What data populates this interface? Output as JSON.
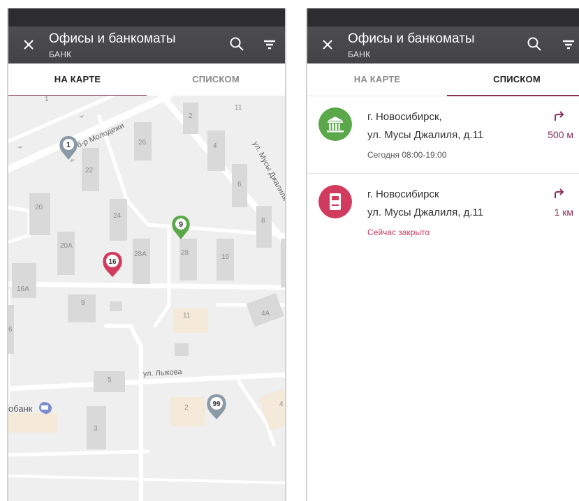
{
  "header": {
    "title": "Офисы и банкоматы",
    "subtitle": "БАНК"
  },
  "tabs": [
    {
      "label": "НА КАРТЕ"
    },
    {
      "label": "СПИСКОМ"
    }
  ],
  "map": {
    "streets": [
      "б-р Молодежи",
      "ул. Мусы Джалиля",
      "ул. Лыкова"
    ],
    "buildings": [
      "2",
      "26",
      "4",
      "22",
      "6",
      "20",
      "24",
      "8",
      "20А",
      "28А",
      "28",
      "10",
      "16А",
      "9",
      "11",
      "4А",
      "6",
      "5",
      "2",
      "4",
      "3",
      "11",
      "1"
    ],
    "poi_label": "обанк",
    "markers": [
      {
        "label": "1",
        "color": "#8a9aa6"
      },
      {
        "label": "9",
        "color": "#5aa84a"
      },
      {
        "label": "16",
        "color": "#d13b5e"
      },
      {
        "label": "99",
        "color": "#8a9aa6"
      }
    ]
  },
  "list": {
    "items": [
      {
        "line1": "г. Новосибирск,",
        "line2": "ул. Мусы Джалиля, д.11",
        "status": "Сегодня 08:00-19:00",
        "distance": "500 м",
        "icon": "bank-building-icon",
        "color": "#5aa84a"
      },
      {
        "line1": "г. Новосибирск",
        "line2": "ул. Мусы Джалиля, д.11",
        "status": "Сейчас закрыто",
        "distance": "1 км",
        "icon": "atm-icon",
        "color": "#d13b5e"
      }
    ]
  },
  "colors": {
    "accent": "#8a2f5b",
    "appbar": "#4a4a4e",
    "closed": "#c4375b"
  }
}
